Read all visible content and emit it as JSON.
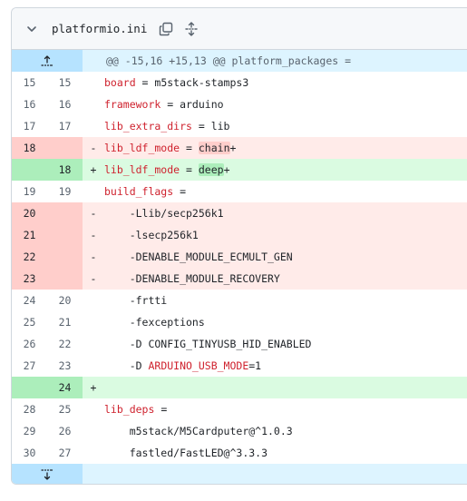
{
  "file": {
    "name": "platformio.ini",
    "icons": {
      "collapse": "chevron-down-icon",
      "copy": "copy-icon",
      "expand": "unfold-icon"
    }
  },
  "hunk_header": "@@ -15,16 +15,13 @@ platform_packages =",
  "lines": [
    {
      "type": "ctx",
      "old": "15",
      "new": "15",
      "sign": "",
      "key": "board",
      "rest": " = m5stack-stamps3"
    },
    {
      "type": "ctx",
      "old": "16",
      "new": "16",
      "sign": "",
      "key": "framework",
      "rest": " = arduino"
    },
    {
      "type": "ctx",
      "old": "17",
      "new": "17",
      "sign": "",
      "key": "lib_extra_dirs",
      "rest": " = lib"
    },
    {
      "type": "del",
      "old": "18",
      "new": "",
      "sign": "-",
      "key": "lib_ldf_mode",
      "rest": " = ",
      "hl": "chain",
      "after": "+"
    },
    {
      "type": "add",
      "old": "",
      "new": "18",
      "sign": "+",
      "key": "lib_ldf_mode",
      "rest": " = ",
      "hl": "deep",
      "after": "+"
    },
    {
      "type": "ctx",
      "old": "19",
      "new": "19",
      "sign": "",
      "key": "build_flags",
      "rest": " ="
    },
    {
      "type": "del",
      "old": "20",
      "new": "",
      "sign": "-",
      "key": "",
      "rest": "    -Llib/secp256k1"
    },
    {
      "type": "del",
      "old": "21",
      "new": "",
      "sign": "-",
      "key": "",
      "rest": "    -lsecp256k1"
    },
    {
      "type": "del",
      "old": "22",
      "new": "",
      "sign": "-",
      "key": "",
      "rest": "    -DENABLE_MODULE_ECMULT_GEN"
    },
    {
      "type": "del",
      "old": "23",
      "new": "",
      "sign": "-",
      "key": "",
      "rest": "    -DENABLE_MODULE_RECOVERY"
    },
    {
      "type": "ctx",
      "old": "24",
      "new": "20",
      "sign": "",
      "key": "",
      "rest": "    -frtti"
    },
    {
      "type": "ctx",
      "old": "25",
      "new": "21",
      "sign": "",
      "key": "",
      "rest": "    -fexceptions"
    },
    {
      "type": "ctx",
      "old": "26",
      "new": "22",
      "sign": "",
      "key": "",
      "rest": "    -D CONFIG_TINYUSB_HID_ENABLED"
    },
    {
      "type": "ctx",
      "old": "27",
      "new": "23",
      "sign": "",
      "key": "",
      "pre": "    -D ",
      "kw": "ARDUINO_USB_MODE",
      "rest": "=1"
    },
    {
      "type": "add",
      "old": "",
      "new": "24",
      "sign": "+",
      "key": "",
      "rest": ""
    },
    {
      "type": "ctx",
      "old": "28",
      "new": "25",
      "sign": "",
      "key": "lib_deps",
      "rest": " ="
    },
    {
      "type": "ctx",
      "old": "29",
      "new": "26",
      "sign": "",
      "key": "",
      "rest": "    m5stack/M5Cardputer@^1.0.3"
    },
    {
      "type": "ctx",
      "old": "30",
      "new": "27",
      "sign": "",
      "key": "",
      "rest": "    fastled/FastLED@^3.3.3"
    }
  ],
  "colors": {
    "keyword": "#cf222e",
    "del_bg": "#ffebe9",
    "add_bg": "#dafbe1",
    "hunk_bg": "#ddf4ff"
  }
}
